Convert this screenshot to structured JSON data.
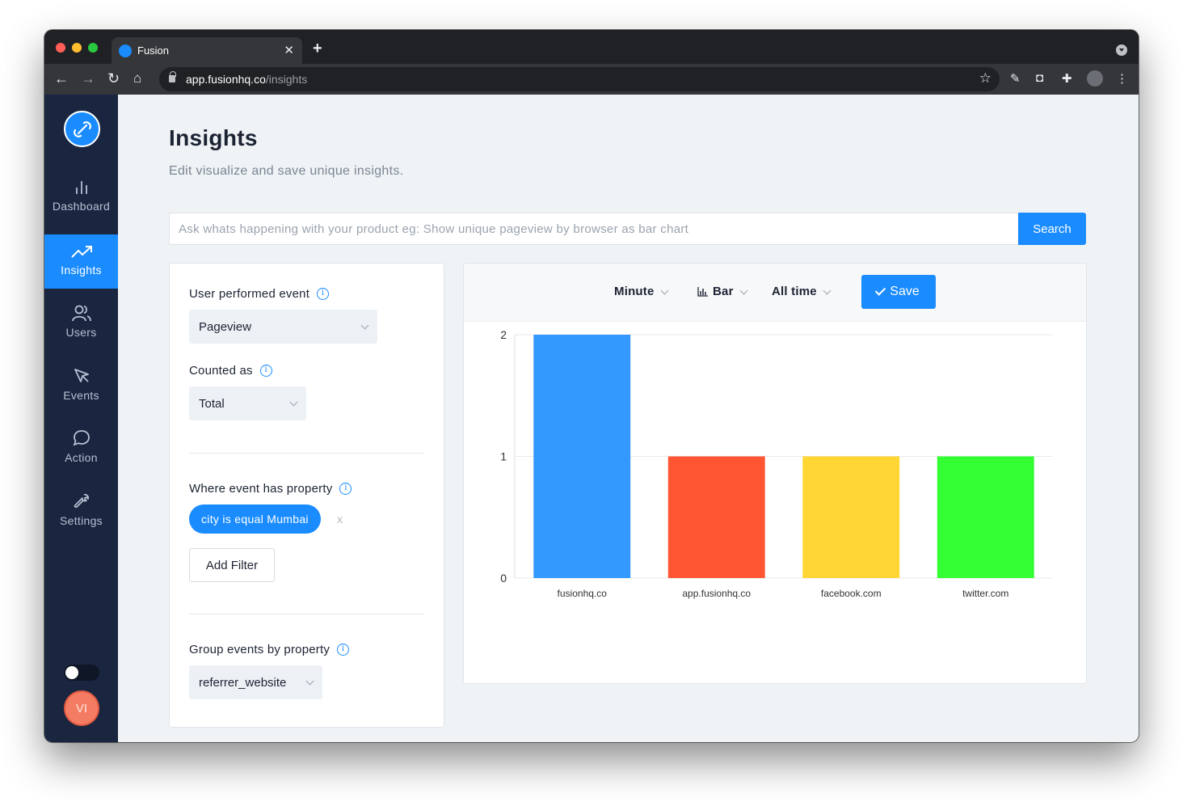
{
  "browser": {
    "tab_title": "Fusion",
    "url_host": "app.fusionhq.co",
    "url_path": "/insights"
  },
  "sidebar": {
    "items": [
      {
        "label": "Dashboard",
        "icon": "bar-chart-icon"
      },
      {
        "label": "Insights",
        "icon": "trending-up-icon",
        "active": true
      },
      {
        "label": "Users",
        "icon": "users-icon"
      },
      {
        "label": "Events",
        "icon": "cursor-icon"
      },
      {
        "label": "Action",
        "icon": "chat-bubble-icon"
      },
      {
        "label": "Settings",
        "icon": "wrench-icon"
      }
    ],
    "avatar_initials": "VI"
  },
  "page": {
    "title": "Insights",
    "subtitle": "Edit visualize and save unique insights."
  },
  "search": {
    "placeholder": "Ask whats happening with your product eg: Show unique pageview by browser as bar chart",
    "button_label": "Search"
  },
  "query": {
    "event_label": "User performed event",
    "event_value": "Pageview",
    "counted_label": "Counted as",
    "counted_value": "Total",
    "where_label": "Where event has property",
    "filter_chip": "city is equal Mumbai",
    "filter_remove": "x",
    "add_filter_label": "Add Filter",
    "group_label": "Group events by property",
    "group_value": "referrer_website"
  },
  "chart_controls": {
    "interval": "Minute",
    "chart_type": "Bar",
    "range": "All time",
    "save_label": "Save"
  },
  "colors": {
    "accent": "#1a8cff",
    "sidebar": "#1a2640"
  },
  "chart_data": {
    "type": "bar",
    "categories": [
      "fusionhq.co",
      "app.fusionhq.co",
      "facebook.com",
      "twitter.com"
    ],
    "values": [
      2,
      1,
      1,
      1
    ],
    "colors": [
      "#3399ff",
      "#ff5533",
      "#ffd633",
      "#33ff33"
    ],
    "yticks": [
      0,
      1,
      2
    ],
    "ylim": [
      0,
      2
    ],
    "grid": true,
    "title": "",
    "xlabel": "",
    "ylabel": ""
  }
}
